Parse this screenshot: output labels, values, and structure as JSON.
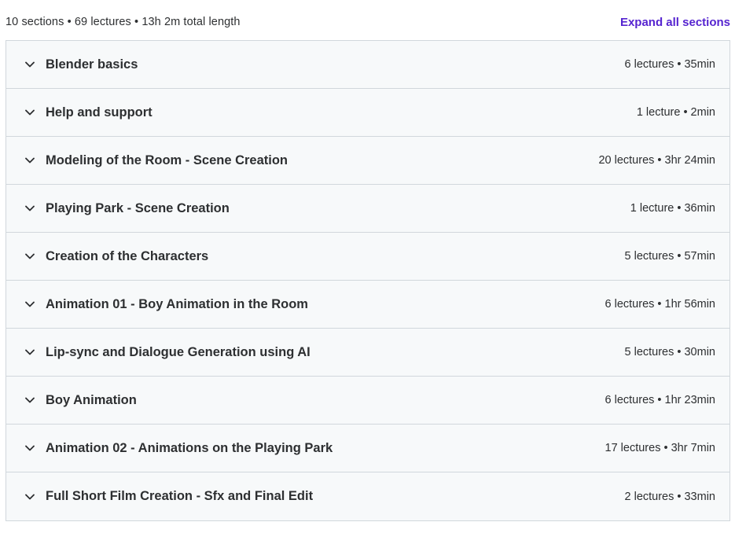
{
  "header": {
    "summary": "10 sections • 69 lectures • 13h 2m total length",
    "expand_label": "Expand all sections"
  },
  "sections": [
    {
      "title": "Blender basics",
      "meta": "6 lectures • 35min"
    },
    {
      "title": "Help and support",
      "meta": "1 lecture • 2min"
    },
    {
      "title": "Modeling of the Room - Scene Creation",
      "meta": "20 lectures • 3hr 24min"
    },
    {
      "title": "Playing Park - Scene Creation",
      "meta": "1 lecture • 36min"
    },
    {
      "title": "Creation of the Characters",
      "meta": "5 lectures • 57min"
    },
    {
      "title": "Animation 01 - Boy Animation in the Room",
      "meta": "6 lectures • 1hr 56min"
    },
    {
      "title": "Lip-sync and Dialogue Generation using AI",
      "meta": "5 lectures • 30min"
    },
    {
      "title": "Boy Animation",
      "meta": "6 lectures • 1hr 23min"
    },
    {
      "title": "Animation 02 - Animations on the Playing Park",
      "meta": "17 lectures • 3hr 7min"
    },
    {
      "title": "Full Short Film Creation - Sfx and Final Edit",
      "meta": "2 lectures • 33min"
    }
  ],
  "icons": {
    "section_toggle": "chevron-down-icon"
  },
  "colors": {
    "accent": "#5624d0",
    "section_bg": "#f7f9fa",
    "border": "#d1d7dc",
    "text": "#2d2f31"
  }
}
